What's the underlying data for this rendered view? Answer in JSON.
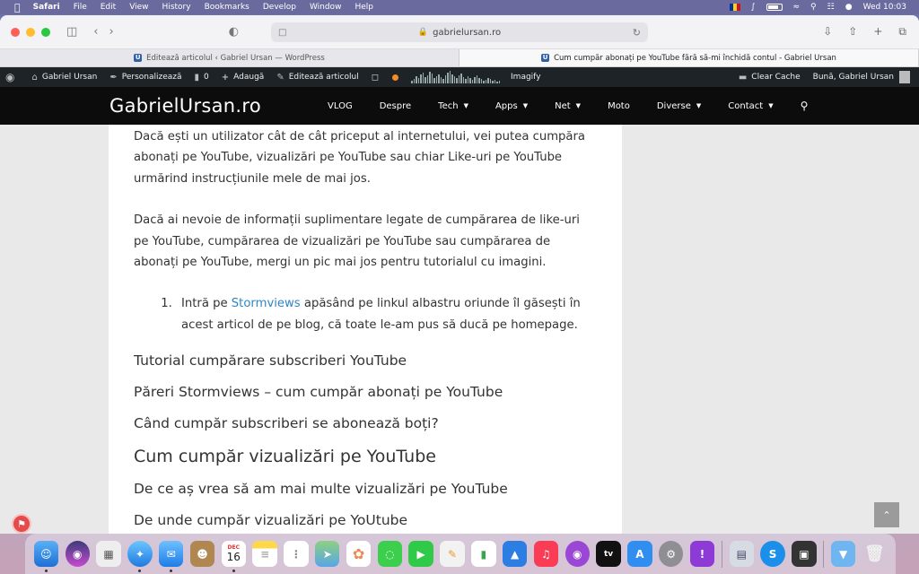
{
  "menubar": {
    "app": "Safari",
    "items": [
      "File",
      "Edit",
      "View",
      "History",
      "Bookmarks",
      "Develop",
      "Window",
      "Help"
    ],
    "clock": "Wed 10:03"
  },
  "browser": {
    "url": "gabrielursan.ro",
    "tabs": [
      {
        "title": "Editează articolul ‹ Gabriel Ursan — WordPress",
        "active": false
      },
      {
        "title": "Cum cumpăr abonați pe YouTube fără să-mi închidă contul - Gabriel Ursan",
        "active": true
      }
    ]
  },
  "adminbar": {
    "user": "Gabriel Ursan",
    "customize": "Personalizează",
    "comments_count": "0",
    "add_new": "Adaugă",
    "edit_post": "Editează articolul",
    "imagify": "Imagify",
    "clear_cache": "Clear Cache",
    "greeting": "Bună, Gabriel Ursan"
  },
  "site": {
    "logo": "GabrielUrsan.ro",
    "nav": [
      {
        "label": "VLOG",
        "dropdown": false
      },
      {
        "label": "Despre",
        "dropdown": false
      },
      {
        "label": "Tech",
        "dropdown": true
      },
      {
        "label": "Apps",
        "dropdown": true
      },
      {
        "label": "Net",
        "dropdown": true
      },
      {
        "label": "Moto",
        "dropdown": false
      },
      {
        "label": "Diverse",
        "dropdown": true
      },
      {
        "label": "Contact",
        "dropdown": true
      }
    ]
  },
  "article": {
    "para1": "Dacă ești un utilizator cât de cât priceput al internetului, vei putea cumpăra abonați pe YouTube, vizualizări pe YouTube sau chiar Like-uri pe YouTube urmărind instrucțiunile mele de mai jos.",
    "para2": "Dacă ai nevoie de informații suplimentare legate de cumpărarea de like-uri pe YouTube, cumpărarea de vizualizări pe YouTube sau cumpărarea de abonați pe YouTube, mergi un pic mai jos pentru tutorialul cu imagini.",
    "step1_before": "Intră pe ",
    "step1_link": "Stormviews",
    "step1_after": " apăsând pe linkul albastru oriunde îl găsești în acest articol de pe blog, că toate le-am pus să ducă pe homepage.",
    "heading1": "Tutorial cumpărare subscriberi YouTube",
    "heading2": "Păreri Stormviews – cum cumpăr abonați pe YouTube",
    "heading3": "Când cumpăr subscriberi se abonează boți?",
    "heading4": "Cum cumpăr vizualizări pe YouTube",
    "heading5": "De ce aș vrea să am mai multe vizualizări pe YouTube",
    "heading6": "De unde cumpăr vizualizări pe YoUtube"
  },
  "dock": {
    "calendar_month": "DEC",
    "calendar_day": "16"
  }
}
